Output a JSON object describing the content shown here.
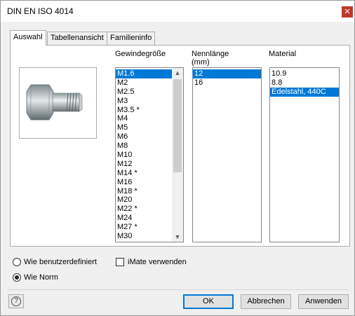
{
  "window": {
    "title": "DIN EN ISO 4014",
    "close_icon": "close-icon"
  },
  "tabs": [
    {
      "label": "Auswahl",
      "active": true
    },
    {
      "label": "Tabellenansicht",
      "active": false
    },
    {
      "label": "Familieninfo",
      "active": false
    }
  ],
  "columns": {
    "gewinde": {
      "label": "Gewindegröße",
      "items": [
        "M1.6",
        "M2",
        "M2.5",
        "M3",
        "M3.5 *",
        "M4",
        "M5",
        "M6",
        "M8",
        "M10",
        "M12",
        "M14 *",
        "M16",
        "M18 *",
        "M20",
        "M22 *",
        "M24",
        "M27 *",
        "M30"
      ],
      "selected": "M1.6"
    },
    "nennlaenge": {
      "label": "Nennlänge\n(mm)",
      "items": [
        "12",
        "16"
      ],
      "selected": "12"
    },
    "material": {
      "label": "Material",
      "items": [
        "10.9",
        "8.8",
        "Edelstahl, 440C"
      ],
      "selected": "Edelstahl, 440C"
    }
  },
  "options": {
    "wie_benutzerdefiniert": {
      "label": "Wie benutzerdefiniert",
      "checked": false
    },
    "wie_norm": {
      "label": "Wie Norm",
      "checked": true
    },
    "imate": {
      "label": "iMate verwenden",
      "checked": false
    }
  },
  "buttons": {
    "help_icon": "question-circle-icon",
    "ok": "OK",
    "cancel": "Abbrechen",
    "apply": "Anwenden"
  },
  "colors": {
    "selection": "#0078d7",
    "close": "#c0392b"
  }
}
